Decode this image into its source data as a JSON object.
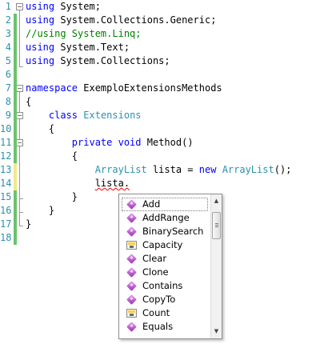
{
  "editor": {
    "lines": [
      {
        "number": "1",
        "parts": [
          {
            "t": "using",
            "c": "kw"
          },
          {
            "t": " System;",
            "c": ""
          }
        ]
      },
      {
        "number": "2",
        "parts": [
          {
            "t": "using",
            "c": "kw"
          },
          {
            "t": " System.Collections.Generic;",
            "c": ""
          }
        ]
      },
      {
        "number": "3",
        "parts": [
          {
            "t": "//using System.Linq;",
            "c": "cmt"
          }
        ]
      },
      {
        "number": "4",
        "parts": [
          {
            "t": "using",
            "c": "kw"
          },
          {
            "t": " System.Text;",
            "c": ""
          }
        ]
      },
      {
        "number": "5",
        "parts": [
          {
            "t": "using",
            "c": "kw"
          },
          {
            "t": " System.Collections;",
            "c": ""
          }
        ]
      },
      {
        "number": "6",
        "parts": []
      },
      {
        "number": "7",
        "parts": [
          {
            "t": "namespace",
            "c": "kw"
          },
          {
            "t": " ExemploExtensionsMethods",
            "c": ""
          }
        ]
      },
      {
        "number": "8",
        "parts": [
          {
            "t": "{",
            "c": ""
          }
        ]
      },
      {
        "number": "9",
        "parts": [
          {
            "t": "    ",
            "c": ""
          },
          {
            "t": "class",
            "c": "kw"
          },
          {
            "t": " ",
            "c": ""
          },
          {
            "t": "Extensions",
            "c": "type"
          }
        ]
      },
      {
        "number": "10",
        "parts": [
          {
            "t": "    {",
            "c": ""
          }
        ]
      },
      {
        "number": "11",
        "parts": [
          {
            "t": "        ",
            "c": ""
          },
          {
            "t": "private",
            "c": "kw"
          },
          {
            "t": " ",
            "c": ""
          },
          {
            "t": "void",
            "c": "kw"
          },
          {
            "t": " Method()",
            "c": ""
          }
        ]
      },
      {
        "number": "12",
        "parts": [
          {
            "t": "        {",
            "c": ""
          }
        ]
      },
      {
        "number": "13",
        "parts": [
          {
            "t": "            ",
            "c": ""
          },
          {
            "t": "ArrayList",
            "c": "type"
          },
          {
            "t": " lista = ",
            "c": ""
          },
          {
            "t": "new",
            "c": "kw"
          },
          {
            "t": " ",
            "c": ""
          },
          {
            "t": "ArrayList",
            "c": "type"
          },
          {
            "t": "();",
            "c": ""
          }
        ]
      },
      {
        "number": "14",
        "parts": [
          {
            "t": "            ",
            "c": ""
          },
          {
            "t": "lista.",
            "c": "squiggle"
          }
        ]
      },
      {
        "number": "15",
        "parts": [
          {
            "t": "        }",
            "c": ""
          }
        ]
      },
      {
        "number": "16",
        "parts": [
          {
            "t": "    }",
            "c": ""
          }
        ]
      },
      {
        "number": "17",
        "parts": [
          {
            "t": "}",
            "c": ""
          }
        ]
      },
      {
        "number": "18",
        "parts": []
      }
    ]
  },
  "completion": {
    "items": [
      {
        "label": "Add",
        "icon": "method-icon",
        "selected": true
      },
      {
        "label": "AddRange",
        "icon": "method-icon"
      },
      {
        "label": "BinarySearch",
        "icon": "method-icon"
      },
      {
        "label": "Capacity",
        "icon": "property-icon"
      },
      {
        "label": "Clear",
        "icon": "method-icon"
      },
      {
        "label": "Clone",
        "icon": "method-icon"
      },
      {
        "label": "Contains",
        "icon": "method-icon"
      },
      {
        "label": "CopyTo",
        "icon": "method-icon"
      },
      {
        "label": "Count",
        "icon": "property-icon"
      },
      {
        "label": "Equals",
        "icon": "method-icon"
      }
    ],
    "scroll_up_glyph": "▲",
    "scroll_down_glyph": "▼"
  },
  "colors": {
    "keyword": "#0000ff",
    "type": "#2b91af",
    "comment": "#008000",
    "line_number": "#2b91af",
    "saved_change": "#6cc36c",
    "unsaved_change": "#f2e98a"
  }
}
